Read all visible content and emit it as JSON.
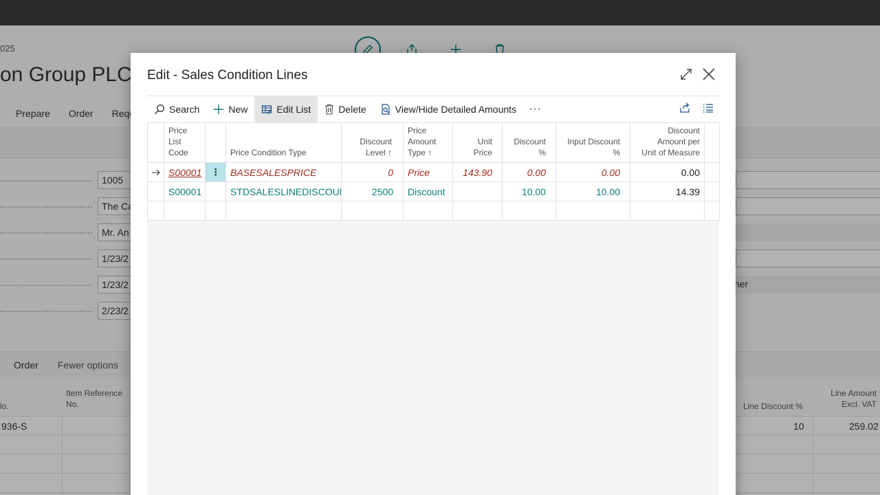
{
  "background": {
    "date_fragment": "025",
    "title_fragment": "on Group PLC",
    "menu": [
      "Prepare",
      "Order",
      "Requ"
    ],
    "fields": [
      "1005",
      "The Ca",
      "Mr. An",
      "1/23/2",
      "1/23/2",
      "2/23/2"
    ],
    "right_field_fragment": "ner",
    "lines_bar": {
      "order": "Order",
      "fewer": "Fewer options"
    },
    "grid_headers": {
      "no": "lo.",
      "item_ref": "Item Reference\nNo.",
      "line_disc": "Line Discount %",
      "line_amount": "Line Amount\nExcl. VAT"
    },
    "grid_row": {
      "no": "936-S",
      "line_disc": "10",
      "line_amount": "259.02"
    }
  },
  "dialog": {
    "title": "Edit - Sales Condition Lines",
    "toolbar": {
      "search": "Search",
      "new": "New",
      "edit_list": "Edit List",
      "delete": "Delete",
      "view_hide": "View/Hide Detailed Amounts",
      "more": "···"
    },
    "columns": {
      "price_list_code": "Price\nList\nCode",
      "price_condition_type": "Price Condition Type",
      "discount_level": "Discount\nLevel ↑",
      "price_amount_type": "Price\nAmount\nType ↑",
      "unit_price": "Unit\nPrice",
      "discount_pct": "Discount\n%",
      "input_discount_pct": "Input Discount\n%",
      "discount_amount_uom": "Discount\nAmount per\nUnit of Measure"
    },
    "rows": [
      {
        "code": "S00001",
        "type": "BASESALESPRICE",
        "level": "0",
        "amount_type": "Price",
        "unit_price": "143.90",
        "discount": "0.00",
        "input_discount": "0.00",
        "discount_amount": "0.00"
      },
      {
        "code": "S00001",
        "type": "STDSALESLINEDISCOUNT",
        "level": "2500",
        "amount_type": "Discount",
        "unit_price": "",
        "discount": "10.00",
        "input_discount": "10.00",
        "discount_amount": "14.39"
      }
    ]
  }
}
